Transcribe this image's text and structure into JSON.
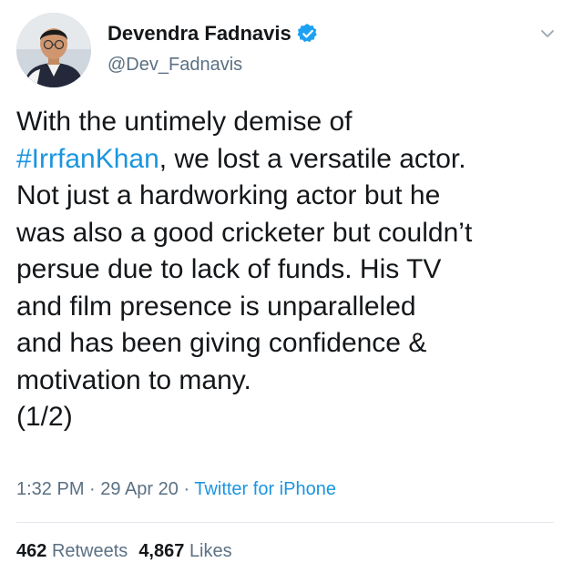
{
  "author": {
    "display_name": "Devendra Fadnavis",
    "handle": "@Dev_Fadnavis",
    "verified": true,
    "verified_icon": "verified-badge-icon",
    "menu_icon": "chevron-down-icon"
  },
  "tweet": {
    "lines": {
      "l1": "With the untimely demise of",
      "l2_hashtag": "#IrrfanKhan",
      "l2_rest": ", we lost a versatile actor.",
      "l3": "Not just a hardworking actor but he",
      "l4": "was also a good cricketer but couldn’t",
      "l5": "persue due to lack of funds. His TV",
      "l6": "and film presence is unparalleled",
      "l7": "and has been giving confidence &",
      "l8": "motivation to many.",
      "l9": "(1/2)"
    }
  },
  "meta": {
    "time": "1:32 PM",
    "sep1": " · ",
    "date": "29 Apr 20",
    "sep2": " · ",
    "source": "Twitter for iPhone"
  },
  "stats": {
    "retweets_count": "462",
    "retweets_label": "Retweets",
    "likes_count": "4,867",
    "likes_label": "Likes"
  },
  "colors": {
    "link": "#1b95e0",
    "secondary_text": "#5b7083",
    "primary_text": "#14171a",
    "divider": "#e1e8ed"
  }
}
